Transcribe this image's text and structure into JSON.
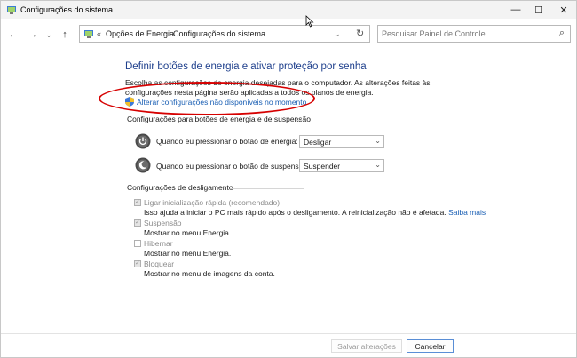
{
  "window": {
    "title": "Configurações do sistema"
  },
  "titlebar_buttons": {
    "minimize": "—",
    "maximize": "☐",
    "close": "✕"
  },
  "nav": {
    "back": "←",
    "forward": "→",
    "dropdown": "⌄",
    "up": "↑"
  },
  "address": {
    "separator": "«",
    "crumb1": "Opções de Energia",
    "arrow": "›",
    "crumb2": "Configurações do sistema",
    "dropdown": "⌄",
    "refresh": "↻"
  },
  "search": {
    "placeholder": "Pesquisar Painel de Controle",
    "icon": "⌕"
  },
  "main": {
    "heading": "Definir botões de energia e ativar proteção por senha",
    "description": "Escolha as configurações de energia desejadas para o computador. As alterações feitas às configurações nesta página serão aplicadas a todos os planos de energia.",
    "change_link": "Alterar configurações não disponíveis no momento"
  },
  "power_section": {
    "title": "Configurações para botões de energia e de suspensão",
    "power_label": "Quando eu pressionar o botão de energia:",
    "power_value": "Desligar",
    "sleep_label": "Quando eu pressionar o botão de suspensão:",
    "sleep_value": "Suspender",
    "arrow": "⌄"
  },
  "shutdown_section": {
    "title": "Configurações de desligamento",
    "items": [
      {
        "title": "Ligar inicialização rápida (recomendado)",
        "desc": "Isso ajuda a iniciar o PC mais rápido após o desligamento. A reinicialização não é afetada.",
        "link": "Saiba mais",
        "checked": true
      },
      {
        "title": "Suspensão",
        "desc": "Mostrar no menu Energia.",
        "checked": true
      },
      {
        "title": "Hibernar",
        "desc": "Mostrar no menu Energia.",
        "checked": false
      },
      {
        "title": "Bloquear",
        "desc": "Mostrar no menu de imagens da conta.",
        "checked": true
      }
    ],
    "tick": "✓"
  },
  "footer": {
    "save": "Salvar alterações",
    "cancel": "Cancelar"
  },
  "colors": {
    "heading": "#1e3f8c",
    "link": "#1a5fb4",
    "annotation": "#d60000"
  }
}
